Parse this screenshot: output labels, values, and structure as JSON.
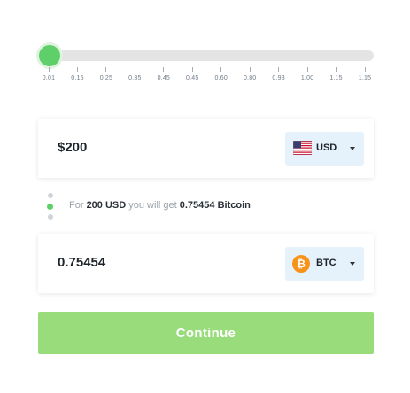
{
  "slider": {
    "selected_value": "0.01",
    "ticks": [
      "0.01",
      "0.15",
      "0.25",
      "0.35",
      "0.45",
      "0.45",
      "0.60",
      "0.80",
      "0.93",
      "1.00",
      "1.15",
      "1.15"
    ]
  },
  "from": {
    "amount": "$200",
    "currency_code": "USD",
    "currency_icon": "us-flag-icon"
  },
  "info": {
    "prefix": "For",
    "amount": "200 USD",
    "middle": "you will get",
    "result": "0.75454 Bitcoin"
  },
  "to": {
    "amount": "0.75454",
    "currency_code": "BTC",
    "currency_icon": "bitcoin-icon",
    "icon_glyph": "₿"
  },
  "continue_label": "Continue",
  "colors": {
    "accent": "#5fcf6a",
    "button": "#99dc7b",
    "currency_bg": "#e5f2fc",
    "bitcoin": "#f7931a"
  }
}
